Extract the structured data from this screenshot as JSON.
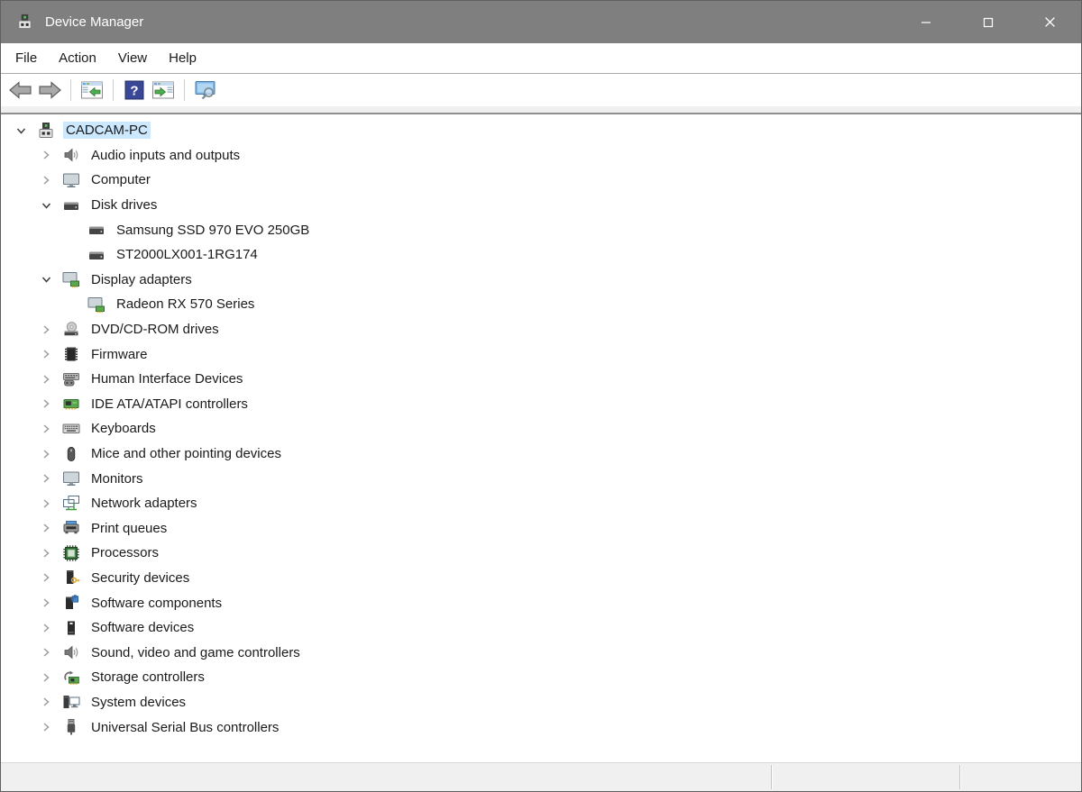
{
  "window": {
    "title": "Device Manager"
  },
  "colors": {
    "titlebar": "#7f7f7f",
    "selection_highlight": "#cce8ff",
    "statusbar": "#f0f0f0",
    "card_green": "#5aa84e",
    "screen_blue": "#2e7bc0"
  },
  "menu": {
    "items": [
      "File",
      "Action",
      "View",
      "Help"
    ]
  },
  "toolbar": {
    "items": [
      {
        "name": "back-button",
        "icon": "back-arrow-icon",
        "symbol": "tb-back"
      },
      {
        "name": "forward-button",
        "icon": "forward-arrow-icon",
        "symbol": "tb-forward"
      },
      {
        "type": "separator"
      },
      {
        "name": "show-console-tree-button",
        "icon": "console-tree-icon",
        "symbol": "tb-console-tree"
      },
      {
        "type": "separator"
      },
      {
        "name": "help-button",
        "icon": "help-icon",
        "symbol": "tb-help"
      },
      {
        "name": "action-pane-button",
        "icon": "action-pane-icon",
        "symbol": "tb-action-pane"
      },
      {
        "type": "separator"
      },
      {
        "name": "scan-hardware-changes-button",
        "icon": "scan-computer-icon",
        "symbol": "tb-scan"
      }
    ]
  },
  "tree": {
    "items": [
      {
        "label": "CADCAM-PC",
        "level": 0,
        "state": "expanded",
        "icon": "device",
        "selected": true
      },
      {
        "label": "Audio inputs and outputs",
        "level": 1,
        "state": "collapsed",
        "icon": "audio"
      },
      {
        "label": "Computer",
        "level": 1,
        "state": "collapsed",
        "icon": "monitor"
      },
      {
        "label": "Disk drives",
        "level": 1,
        "state": "expanded",
        "icon": "disk"
      },
      {
        "label": "Samsung SSD 970 EVO 250GB",
        "level": 2,
        "state": "none",
        "icon": "disk"
      },
      {
        "label": "ST2000LX001-1RG174",
        "level": 2,
        "state": "none",
        "icon": "disk"
      },
      {
        "label": "Display adapters",
        "level": 1,
        "state": "expanded",
        "icon": "display-adapter"
      },
      {
        "label": "Radeon RX 570 Series",
        "level": 2,
        "state": "none",
        "icon": "display-adapter"
      },
      {
        "label": "DVD/CD-ROM drives",
        "level": 1,
        "state": "collapsed",
        "icon": "dvd"
      },
      {
        "label": "Firmware",
        "level": 1,
        "state": "collapsed",
        "icon": "firmware"
      },
      {
        "label": "Human Interface Devices",
        "level": 1,
        "state": "collapsed",
        "icon": "hid"
      },
      {
        "label": "IDE ATA/ATAPI controllers",
        "level": 1,
        "state": "collapsed",
        "icon": "ide"
      },
      {
        "label": "Keyboards",
        "level": 1,
        "state": "collapsed",
        "icon": "keyboard"
      },
      {
        "label": "Mice and other pointing devices",
        "level": 1,
        "state": "collapsed",
        "icon": "mouse"
      },
      {
        "label": "Monitors",
        "level": 1,
        "state": "collapsed",
        "icon": "monitor"
      },
      {
        "label": "Network adapters",
        "level": 1,
        "state": "collapsed",
        "icon": "network"
      },
      {
        "label": "Print queues",
        "level": 1,
        "state": "collapsed",
        "icon": "printer"
      },
      {
        "label": "Processors",
        "level": 1,
        "state": "collapsed",
        "icon": "processor"
      },
      {
        "label": "Security devices",
        "level": 1,
        "state": "collapsed",
        "icon": "security"
      },
      {
        "label": "Software components",
        "level": 1,
        "state": "collapsed",
        "icon": "software-component"
      },
      {
        "label": "Software devices",
        "level": 1,
        "state": "collapsed",
        "icon": "software-device"
      },
      {
        "label": "Sound, video and game controllers",
        "level": 1,
        "state": "collapsed",
        "icon": "audio"
      },
      {
        "label": "Storage controllers",
        "level": 1,
        "state": "collapsed",
        "icon": "storage"
      },
      {
        "label": "System devices",
        "level": 1,
        "state": "collapsed",
        "icon": "system"
      },
      {
        "label": "Universal Serial Bus controllers",
        "level": 1,
        "state": "collapsed",
        "icon": "usb"
      }
    ]
  },
  "statusbar": {
    "panes": [
      "",
      "",
      ""
    ]
  }
}
